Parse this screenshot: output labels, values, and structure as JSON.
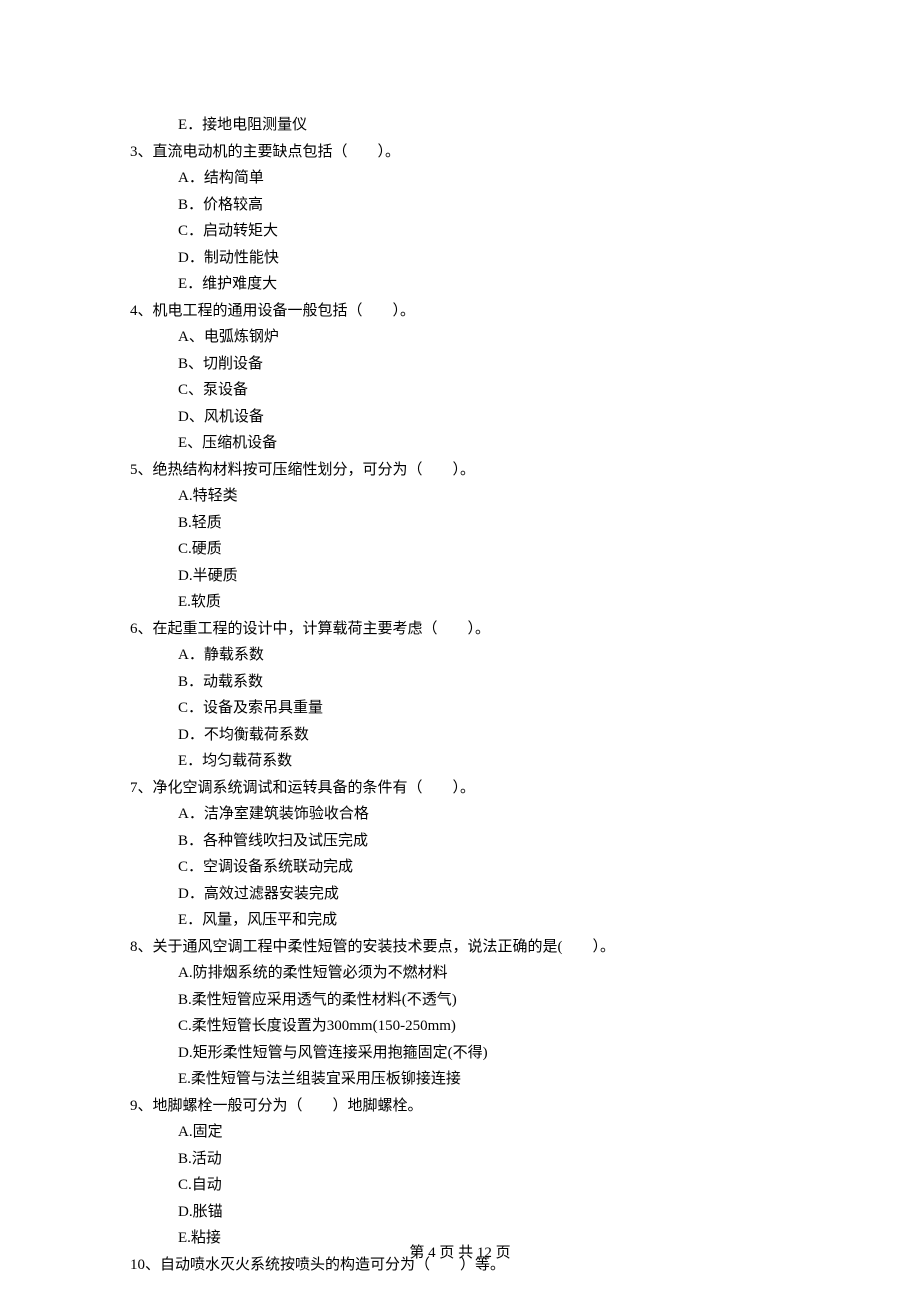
{
  "leadingOption": "E．接地电阻测量仪",
  "questions": [
    {
      "num": "3、",
      "stem": "直流电动机的主要缺点包括（　　）。",
      "options": [
        "A．结构简单",
        "B．价格较高",
        "C．启动转矩大",
        "D．制动性能快",
        "E．维护难度大"
      ]
    },
    {
      "num": "4、",
      "stem": "机电工程的通用设备一般包括（　　）。",
      "options": [
        "A、电弧炼钢炉",
        "B、切削设备",
        "C、泵设备",
        "D、风机设备",
        "E、压缩机设备"
      ]
    },
    {
      "num": "5、",
      "stem": "绝热结构材料按可压缩性划分，可分为（　　）。",
      "options": [
        "A.特轻类",
        "B.轻质",
        "C.硬质",
        "D.半硬质",
        "E.软质"
      ]
    },
    {
      "num": "6、",
      "stem": "在起重工程的设计中，计算载荷主要考虑（　　）。",
      "options": [
        "A．静载系数",
        "B．动载系数",
        "C．设备及索吊具重量",
        "D．不均衡载荷系数",
        "E．均匀载荷系数"
      ]
    },
    {
      "num": "7、",
      "stem": "净化空调系统调试和运转具备的条件有（　　）。",
      "options": [
        "A．洁净室建筑装饰验收合格",
        "B．各种管线吹扫及试压完成",
        "C．空调设备系统联动完成",
        "D．高效过滤器安装完成",
        "E．风量，风压平和完成"
      ]
    },
    {
      "num": "8、",
      "stem": "关于通风空调工程中柔性短管的安装技术要点，说法正确的是(　　）。",
      "options": [
        "A.防排烟系统的柔性短管必须为不燃材料",
        "B.柔性短管应采用透气的柔性材料(不透气)",
        "C.柔性短管长度设置为300mm(150-250mm)",
        "D.矩形柔性短管与风管连接采用抱箍固定(不得)",
        "E.柔性短管与法兰组装宜采用压板铆接连接"
      ]
    },
    {
      "num": "9、",
      "stem": "地脚螺栓一般可分为（　　）地脚螺栓。",
      "options": [
        "A.固定",
        "B.活动",
        "C.自动",
        "D.胀锚",
        "E.粘接"
      ]
    },
    {
      "num": "10、",
      "stem": "自动喷水灭火系统按喷头的构造可分为（　　）等。",
      "options": []
    }
  ],
  "footer": "第 4 页 共 12 页"
}
